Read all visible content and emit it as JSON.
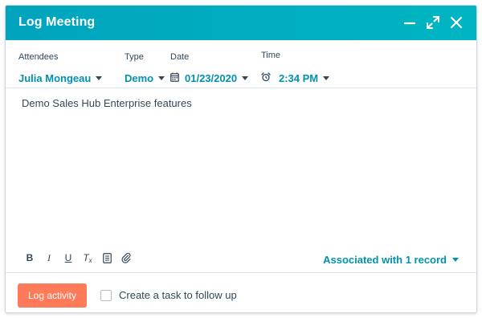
{
  "dialog": {
    "title": "Log Meeting",
    "controls": {
      "minimize_icon": "minimize-icon",
      "expand_icon": "expand-icon",
      "close_icon": "close-icon"
    }
  },
  "meta": {
    "attendees": {
      "label": "Attendees",
      "value": "Julia Mongeau"
    },
    "type": {
      "label": "Type",
      "value": "Demo"
    },
    "date": {
      "label": "Date",
      "value": "01/23/2020",
      "icon": "calendar-icon"
    },
    "time": {
      "label": "Time",
      "value": "2:34 PM",
      "icon": "alarm-clock-icon"
    }
  },
  "body": {
    "text": "Demo Sales Hub Enterprise features"
  },
  "toolbar": {
    "tools": [
      {
        "name": "bold",
        "glyph": "B"
      },
      {
        "name": "italic",
        "glyph": "I"
      },
      {
        "name": "underline",
        "glyph": "U"
      },
      {
        "name": "clear-format",
        "glyph": "T"
      },
      {
        "name": "snippet",
        "glyph": ""
      },
      {
        "name": "attachment",
        "glyph": ""
      }
    ],
    "associated_label": "Associated with 1 record"
  },
  "footer": {
    "log_button_label": "Log activity",
    "followup_label": "Create a task to follow up",
    "followup_checked": false
  },
  "colors": {
    "header": "#00a4bd",
    "link": "#0091ae",
    "primary_button": "#ff7a59",
    "text": "#33475b"
  }
}
